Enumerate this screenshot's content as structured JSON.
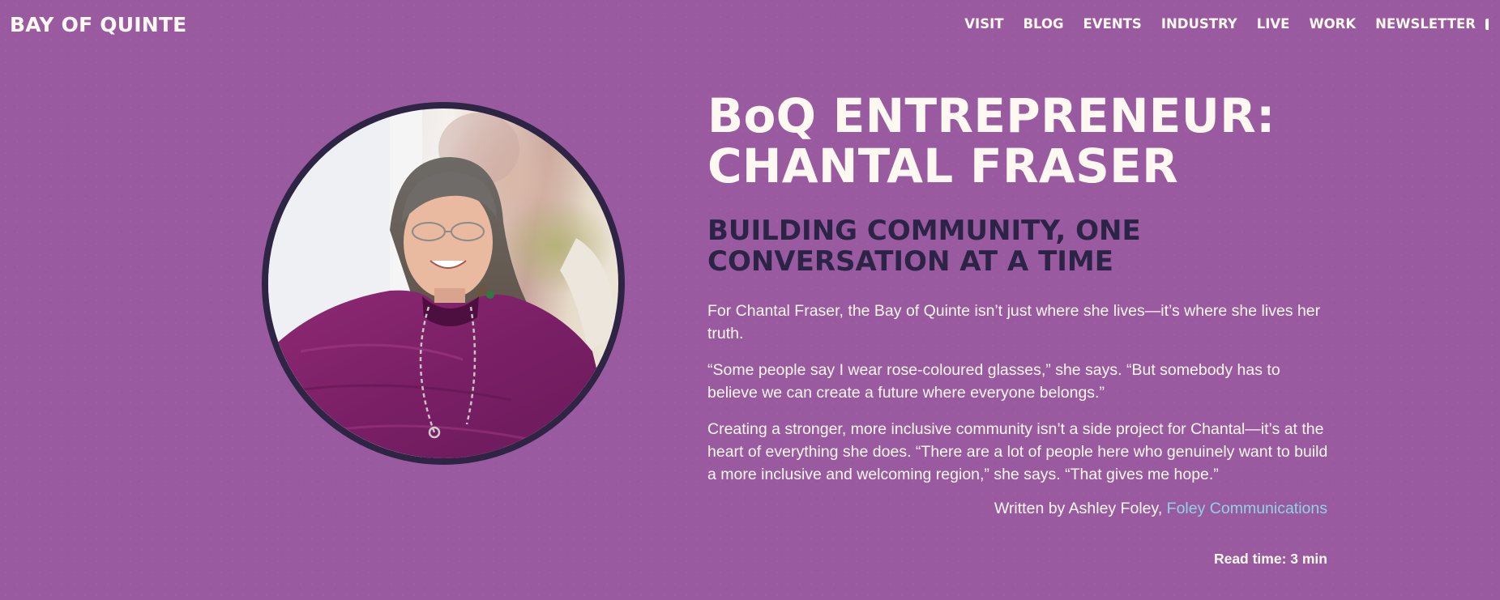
{
  "brand": {
    "logo_text": "BAY OF QUINTE"
  },
  "nav": {
    "items": [
      "VISIT",
      "BLOG",
      "EVENTS",
      "INDUSTRY",
      "LIVE",
      "WORK",
      "NEWSLETTER"
    ]
  },
  "hero": {
    "image_subject": "portrait of Chantal Fraser",
    "image_frame": "circle",
    "frame_color": "#2e2545"
  },
  "article": {
    "title_line1": "BoQ ENTREPRENEUR:",
    "title_line2": "CHANTAL FRASER",
    "subtitle_line1": "BUILDING COMMUNITY, ONE",
    "subtitle_line2": "CONVERSATION AT A TIME",
    "paragraphs": [
      "For Chantal Fraser, the Bay of Quinte isn’t just where she lives—it’s where she lives her truth.",
      "“Some people say I wear rose-coloured glasses,” she says. “But somebody has to believe we can create a future where everyone belongs.”",
      "Creating a stronger, more inclusive community isn’t a side project for Chantal—it’s at the heart of everything she does. “There are a lot of people here who genuinely want to build a more inclusive and welcoming region,” she says. “That gives me hope.”"
    ],
    "byline_prefix": "Written by Ashley Foley,",
    "byline_link": "Foley Communications",
    "read_time": "Read time: 3 min"
  },
  "colors": {
    "background": "#9a5aa0",
    "text_light": "#fdf9f0",
    "subtitle_dark": "#2c2446",
    "link": "#8fd3e6"
  }
}
